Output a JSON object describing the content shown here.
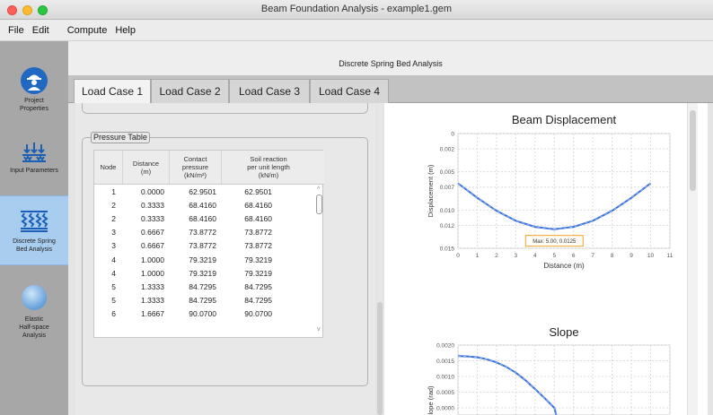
{
  "window": {
    "title": "Beam Foundation Analysis - example1.gem"
  },
  "menu": [
    "File",
    "Edit",
    "Compute",
    "Help"
  ],
  "sidebar": {
    "items": [
      {
        "label_lines": [
          "Project",
          "Properties"
        ],
        "icon": "engineer-icon",
        "active": false
      },
      {
        "label_lines": [
          "Input Parameters"
        ],
        "icon": "load-arrows-icon",
        "active": false
      },
      {
        "label_lines": [
          "Discrete Spring",
          "Bed Analysis"
        ],
        "icon": "spring-bed-icon",
        "active": true
      },
      {
        "label_lines": [
          "Elastic",
          "Half-space",
          "Analysis"
        ],
        "icon": "sphere-icon",
        "active": false
      }
    ]
  },
  "panel": {
    "title": "Discrete Spring Bed Analysis"
  },
  "tabs": [
    {
      "label": "Load Case 1",
      "active": true
    },
    {
      "label": "Load Case 2",
      "active": false
    },
    {
      "label": "Load Case 3",
      "active": false
    },
    {
      "label": "Load Case 4",
      "active": false
    }
  ],
  "pressure_table": {
    "legend": "Pressure Table",
    "columns": [
      [
        "Node"
      ],
      [
        "Distance",
        "(m)"
      ],
      [
        "Contact",
        "pressure",
        "(kN/m²)"
      ],
      [
        "Soil reaction",
        "per unit length",
        "(kN/m)"
      ]
    ],
    "rows": [
      [
        "1",
        "0.0000",
        "62.9501",
        "62.9501"
      ],
      [
        "2",
        "0.3333",
        "68.4160",
        "68.4160"
      ],
      [
        "2",
        "0.3333",
        "68.4160",
        "68.4160"
      ],
      [
        "3",
        "0.6667",
        "73.8772",
        "73.8772"
      ],
      [
        "3",
        "0.6667",
        "73.8772",
        "73.8772"
      ],
      [
        "4",
        "1.0000",
        "79.3219",
        "79.3219"
      ],
      [
        "4",
        "1.0000",
        "79.3219",
        "79.3219"
      ],
      [
        "5",
        "1.3333",
        "84.7295",
        "84.7295"
      ],
      [
        "5",
        "1.3333",
        "84.7295",
        "84.7295"
      ],
      [
        "6",
        "1.6667",
        "90.0700",
        "90.0700"
      ]
    ]
  },
  "chart_data": [
    {
      "type": "line",
      "title": "Beam Displacement",
      "xlabel": "Distance  (m)",
      "ylabel": "Displacement  (m)",
      "xlim": [
        0,
        11
      ],
      "ylim": [
        0.015,
        0
      ],
      "y_inverted": true,
      "x_ticks": [
        "0",
        "1",
        "2",
        "3",
        "4",
        "5",
        "6",
        "7",
        "8",
        "9",
        "10",
        "11"
      ],
      "y_ticks": [
        "0",
        "0.002",
        "0.005",
        "0.007",
        "0.010",
        "0.012",
        "0.015"
      ],
      "grid": true,
      "annotation": "Max: 5.00, 0.0125",
      "line_color": "#3a6fd8",
      "series": [
        {
          "x": [
            0,
            1,
            2,
            3,
            4,
            5,
            6,
            7,
            8,
            9,
            10
          ],
          "y": [
            0.0065,
            0.0084,
            0.0101,
            0.0114,
            0.0122,
            0.0125,
            0.0122,
            0.0114,
            0.0101,
            0.0084,
            0.0065
          ]
        }
      ]
    },
    {
      "type": "line",
      "title": "Slope",
      "ylabel": "Slope  (rad)",
      "y_ticks": [
        "0.0020",
        "0.0015",
        "0.0010",
        "0.0005",
        "0.0000"
      ],
      "ylim": [
        0,
        0.002
      ],
      "xlim": [
        0,
        11
      ],
      "grid": true,
      "line_color": "#3a6fd8",
      "series": [
        {
          "x": [
            0,
            0.5,
            1,
            1.5,
            2,
            2.5,
            3,
            3.5,
            4,
            4.5,
            5
          ],
          "y": [
            0.00165,
            0.00164,
            0.00161,
            0.00155,
            0.00145,
            0.00131,
            0.00112,
            0.00088,
            0.0006,
            0.00031,
            0.0
          ]
        }
      ]
    }
  ]
}
